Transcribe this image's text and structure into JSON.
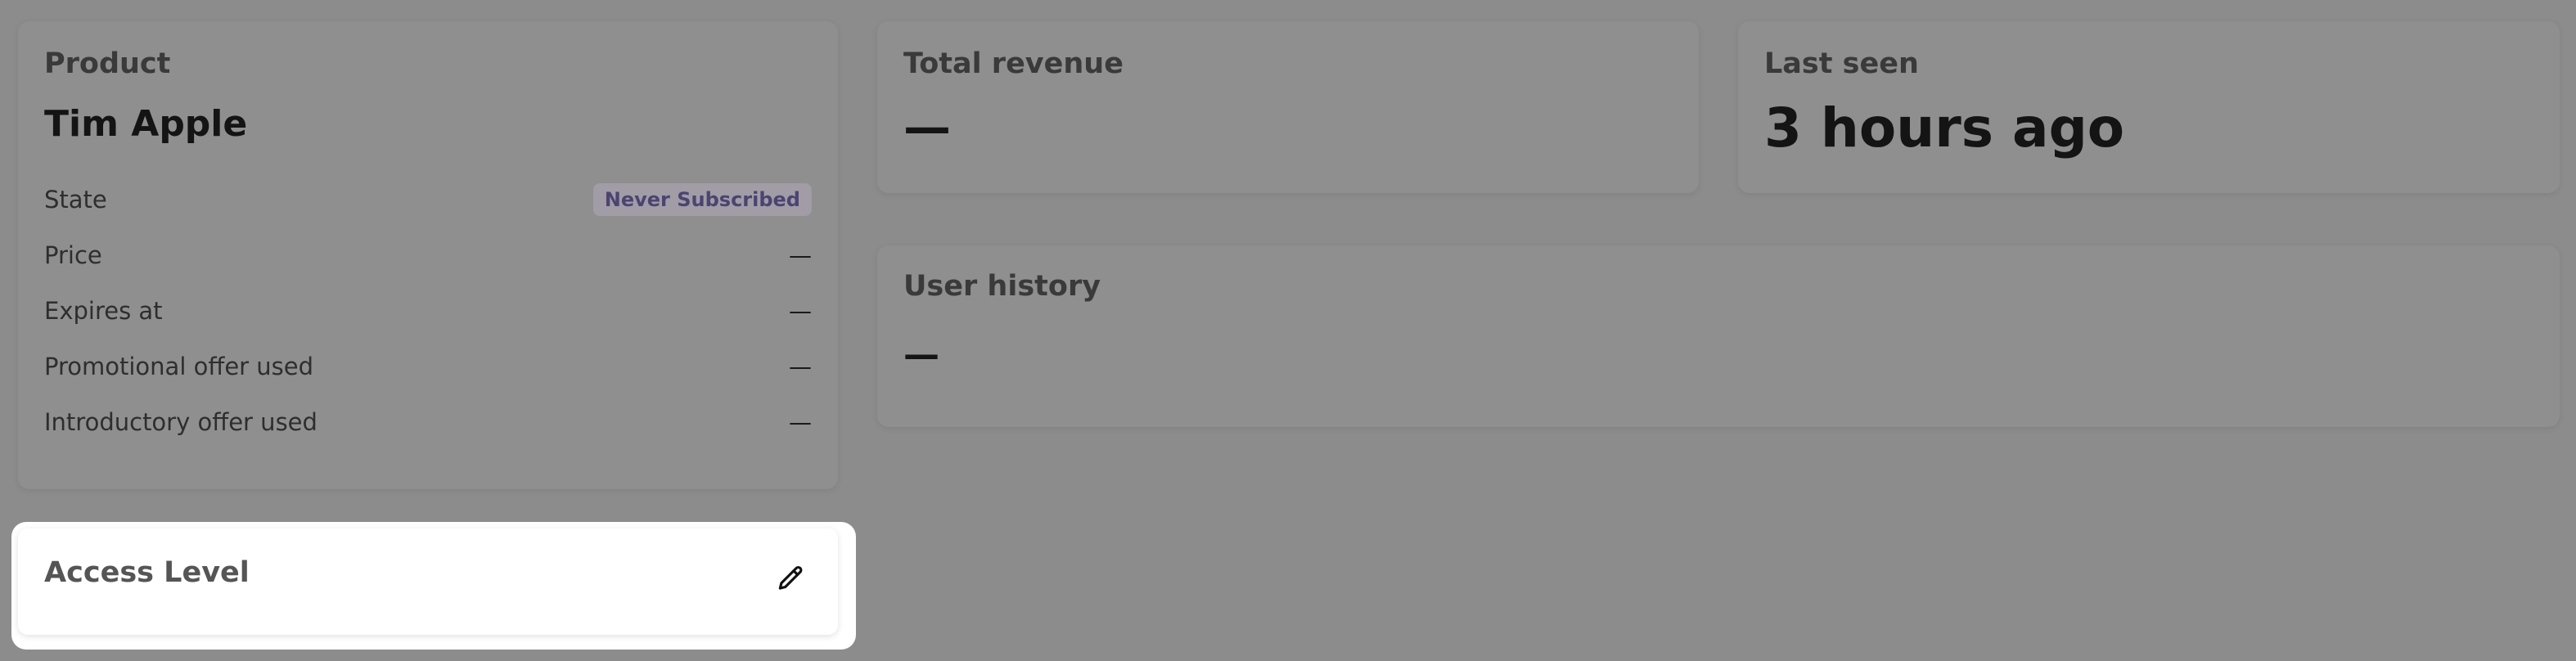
{
  "product": {
    "title": "Product",
    "name": "Tim Apple",
    "rows": [
      {
        "label": "State",
        "value": "Never Subscribed"
      },
      {
        "label": "Price",
        "value": "—"
      },
      {
        "label": "Expires at",
        "value": "—"
      },
      {
        "label": "Promotional offer used",
        "value": "—"
      },
      {
        "label": "Introductory offer used",
        "value": "—"
      }
    ]
  },
  "revenue": {
    "title": "Total revenue",
    "value": "—"
  },
  "last_seen": {
    "title": "Last seen",
    "value": "3 hours ago"
  },
  "history": {
    "title": "User history",
    "value": "—"
  },
  "access": {
    "title": "Access Level",
    "edit_icon": "pencil-icon"
  },
  "colors": {
    "overlay": "#8c8c8c",
    "badge_bg": "#a19ca6",
    "badge_text": "#4c4470",
    "highlight": "#ffffff"
  }
}
